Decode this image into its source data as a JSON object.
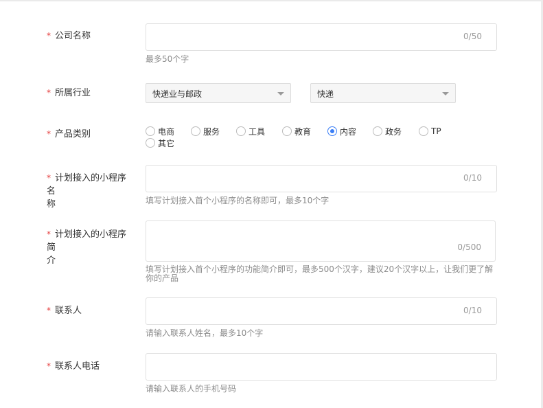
{
  "form": {
    "company_name": {
      "label": "公司名称",
      "count": "0/50",
      "hint": "最多50个字"
    },
    "industry": {
      "label": "所属行业",
      "primary": "快递业与邮政",
      "secondary": "快递"
    },
    "category": {
      "label": "产品类别",
      "options": [
        "电商",
        "服务",
        "工具",
        "教育",
        "内容",
        "政务",
        "TP",
        "其它"
      ],
      "selected": "内容"
    },
    "app_name": {
      "label_line1": "计划接入的小程序名",
      "label_line2": "称",
      "count": "0/10",
      "hint": "填写计划接入首个小程序的名称即可，最多10个字"
    },
    "app_intro": {
      "label_line1": "计划接入的小程序简",
      "label_line2": "介",
      "count": "0/500",
      "hint_line1": "填写计划接入首个小程序的功能简介即可，最多500个汉字，建议20个汉字以上，让我们更了解",
      "hint_line2": "你的产品"
    },
    "contact": {
      "label": "联系人",
      "count": "0/10",
      "hint": "请输入联系人姓名，最多10个字"
    },
    "contact_phone": {
      "label": "联系人电话",
      "hint": "请输入联系人的手机号码"
    },
    "required_mark": "*"
  },
  "colors": {
    "required": "#e53e3e",
    "accent": "#3a7ef6",
    "hint": "#8c8c8c"
  }
}
